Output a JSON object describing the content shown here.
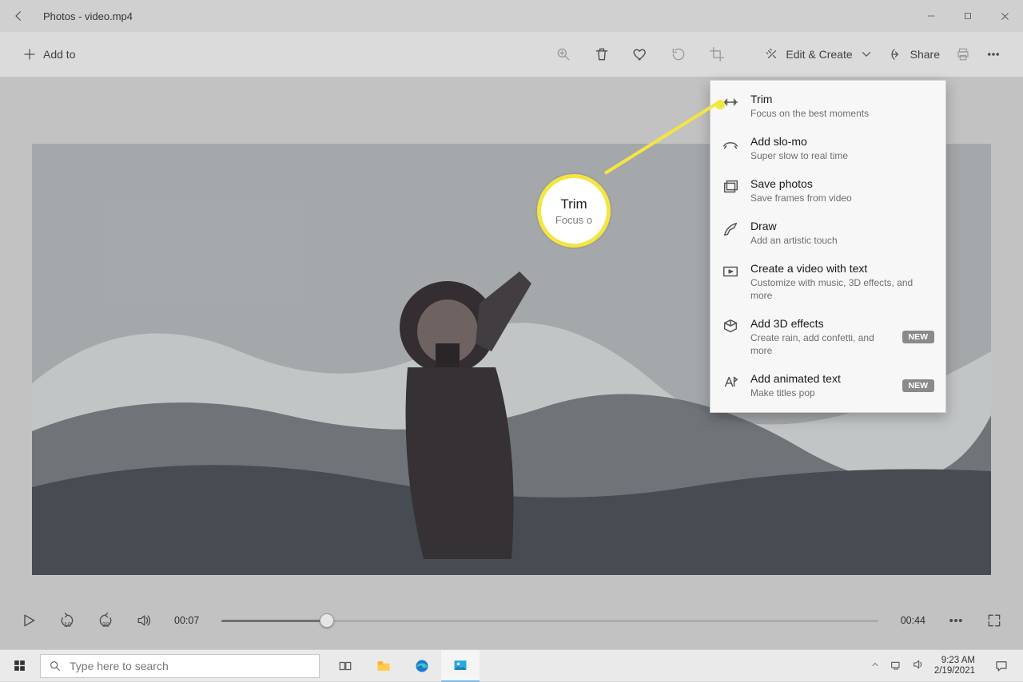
{
  "window": {
    "title": "Photos - video.mp4"
  },
  "toolbar": {
    "add_to": "Add to",
    "edit_create": "Edit & Create",
    "share": "Share"
  },
  "dropdown": {
    "items": [
      {
        "title": "Trim",
        "sub": "Focus on the best moments",
        "icon": "trim-icon"
      },
      {
        "title": "Add slo-mo",
        "sub": "Super slow to real time",
        "icon": "slomo-icon"
      },
      {
        "title": "Save photos",
        "sub": "Save frames from video",
        "icon": "save-photos-icon"
      },
      {
        "title": "Draw",
        "sub": "Add an artistic touch",
        "icon": "draw-icon"
      },
      {
        "title": "Create a video with text",
        "sub": "Customize with music, 3D effects, and more",
        "icon": "video-text-icon"
      },
      {
        "title": "Add 3D effects",
        "sub": "Create rain, add confetti, and more",
        "icon": "effects-3d-icon",
        "badge": "NEW"
      },
      {
        "title": "Add animated text",
        "sub": "Make titles pop",
        "icon": "animated-text-icon",
        "badge": "NEW"
      }
    ]
  },
  "callout": {
    "title": "Trim",
    "sub": "Focus o"
  },
  "player": {
    "current": "00:07",
    "duration": "00:44"
  },
  "taskbar": {
    "search_placeholder": "Type here to search",
    "time": "9:23 AM",
    "date": "2/19/2021"
  }
}
